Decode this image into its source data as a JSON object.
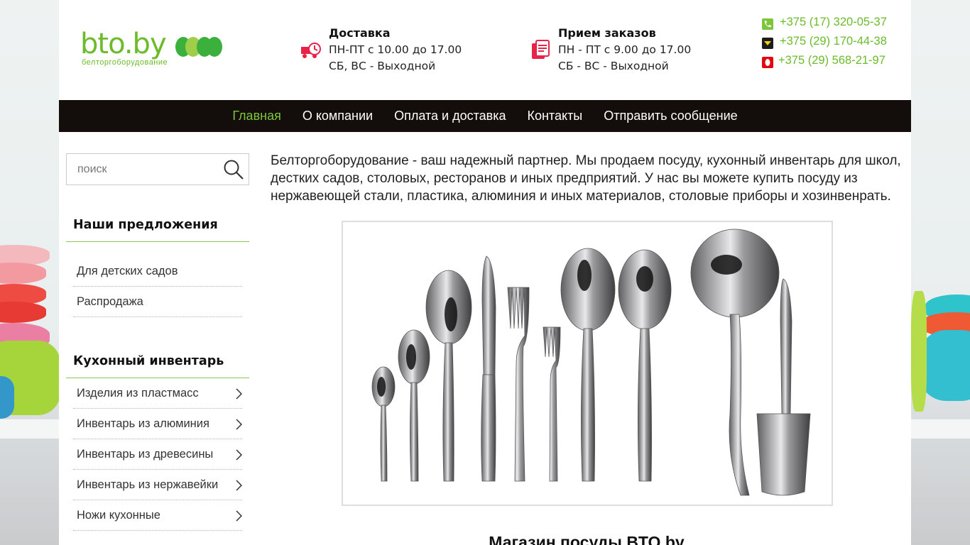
{
  "logo": {
    "text": "bto.by",
    "subtitle": "белторгоборудование"
  },
  "delivery": {
    "title": "Доставка",
    "line1": "ПН-ПТ с 10.00 до 17.00",
    "line2": "СБ, ВС - Выходной"
  },
  "orders": {
    "title": "Прием заказов",
    "line1": "ПН - ПТ с 9.00 до 17.00",
    "line2": "СБ - ВС - Выходной"
  },
  "phones": [
    {
      "number": "+375 (17) 320-05-37",
      "icon": "phone-icon"
    },
    {
      "number": "+375 (29) 170-44-38",
      "icon": "velcom-icon"
    },
    {
      "number": "+375 (29) 568-21-97",
      "icon": "mts-icon"
    }
  ],
  "nav": [
    {
      "label": "Главная",
      "active": true
    },
    {
      "label": "О компании"
    },
    {
      "label": "Оплата и доставка"
    },
    {
      "label": "Контакты"
    },
    {
      "label": "Отправить сообщение"
    }
  ],
  "search": {
    "placeholder": "поиск"
  },
  "offers": {
    "title": "Наши предложения",
    "items": [
      "Для детских садов",
      "Распродажа"
    ]
  },
  "kitchen": {
    "title": "Кухонный инвентарь",
    "items": [
      "Изделия из пластмасс",
      "Инвентарь из алюминия",
      "Инвентарь из древесины",
      "Инвентарь из нержавейки",
      "Ножи кухонные"
    ]
  },
  "main": {
    "intro": "Белторгоборудование - ваш надежный партнер. Мы продаем посуду, кухонный инвентарь для школ, дестких садов, столовых, ресторанов и иных предприятий. У нас вы можете купить посуду из нержавеющей стали, пластика, алюминия и иных материалов, столовые приборы и хозинвенрать.",
    "heading": "Магазин посуды BTO.by"
  },
  "colors": {
    "accent": "#6cbb2b",
    "nav_bg": "#130e0c",
    "icon_red": "#e8234a"
  }
}
